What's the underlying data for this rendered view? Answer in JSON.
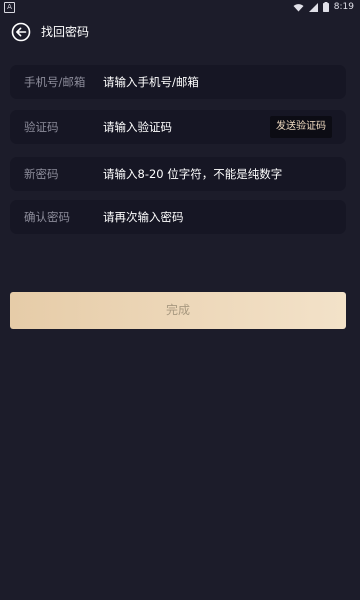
{
  "status_bar": {
    "left_icon_letter": "A",
    "time": "8:19"
  },
  "header": {
    "title": "找回密码"
  },
  "form": {
    "phone": {
      "label": "手机号/邮箱",
      "placeholder": "请输入手机号/邮箱"
    },
    "code": {
      "label": "验证码",
      "placeholder": "请输入验证码",
      "send_label": "发送验证码"
    },
    "new_password": {
      "label": "新密码",
      "placeholder": "请输入8-20 位字符，不能是纯数字"
    },
    "confirm_password": {
      "label": "确认密码",
      "placeholder": "请再次输入密码"
    }
  },
  "submit": {
    "label": "完成"
  },
  "colors": {
    "background": "#1c1c2a",
    "field_background": "#161624",
    "accent_gold_start": "#e6cca8",
    "accent_gold_end": "#f3e2c9",
    "send_button_text": "#f1dcc2"
  }
}
